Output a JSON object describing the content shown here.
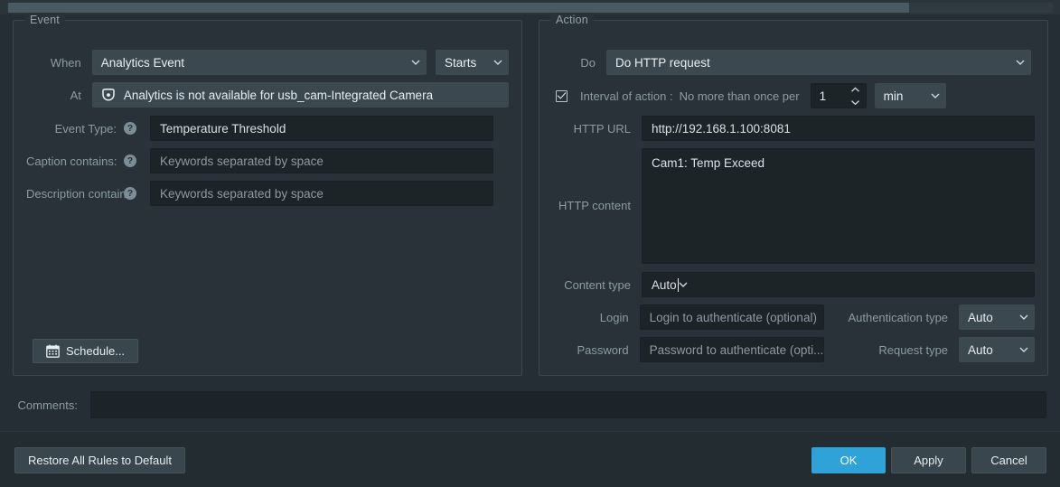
{
  "window": {
    "scrollbar": {
      "name": "horizontal-scrollbar"
    }
  },
  "event_panel": {
    "legend": "Event",
    "when_label": "When",
    "when_value": "Analytics Event",
    "state_value": "Starts",
    "at_label": "At",
    "at_value": "Analytics is not available for usb_cam-Integrated Camera",
    "at_icon": "dome-camera-icon",
    "event_type_label": "Event Type:",
    "event_type_value": "Temperature Threshold",
    "caption_label": "Caption contains:",
    "caption_placeholder": "Keywords separated by space",
    "caption_value": "",
    "description_label": "Description contains:",
    "description_placeholder": "Keywords separated by space",
    "description_value": "",
    "help_glyph": "?",
    "schedule_button": "Schedule..."
  },
  "action_panel": {
    "legend": "Action",
    "do_label": "Do",
    "do_value": "Do HTTP request",
    "interval_checked": true,
    "interval_label": "Interval of action :",
    "interval_sublabel": "No more than once per",
    "interval_value": "1",
    "interval_unit": "min",
    "http_url_label": "HTTP URL",
    "http_url_value": "http://192.168.1.100:8081",
    "http_content_label": "HTTP content",
    "http_content_value": "Cam1: Temp Exceed",
    "content_type_label": "Content type",
    "content_type_value": "Auto",
    "login_label": "Login",
    "login_placeholder": "Login to authenticate (optional)",
    "login_value": "",
    "auth_type_label": "Authentication type",
    "auth_type_value": "Auto",
    "password_label": "Password",
    "password_placeholder": "Password to authenticate (opti...",
    "password_value": "",
    "request_type_label": "Request type",
    "request_type_value": "Auto"
  },
  "footer": {
    "comments_label": "Comments:",
    "comments_value": "",
    "restore_button": "Restore All Rules to Default",
    "ok_button": "OK",
    "apply_button": "Apply",
    "cancel_button": "Cancel"
  },
  "colors": {
    "accent": "#2fa2d8",
    "panel_bg": "#283238",
    "window_bg": "#242e34",
    "field_bg": "#1d2428",
    "combo_bg": "#3b4850",
    "label_text": "#8c9ba4",
    "value_text": "#dfe5e8"
  }
}
